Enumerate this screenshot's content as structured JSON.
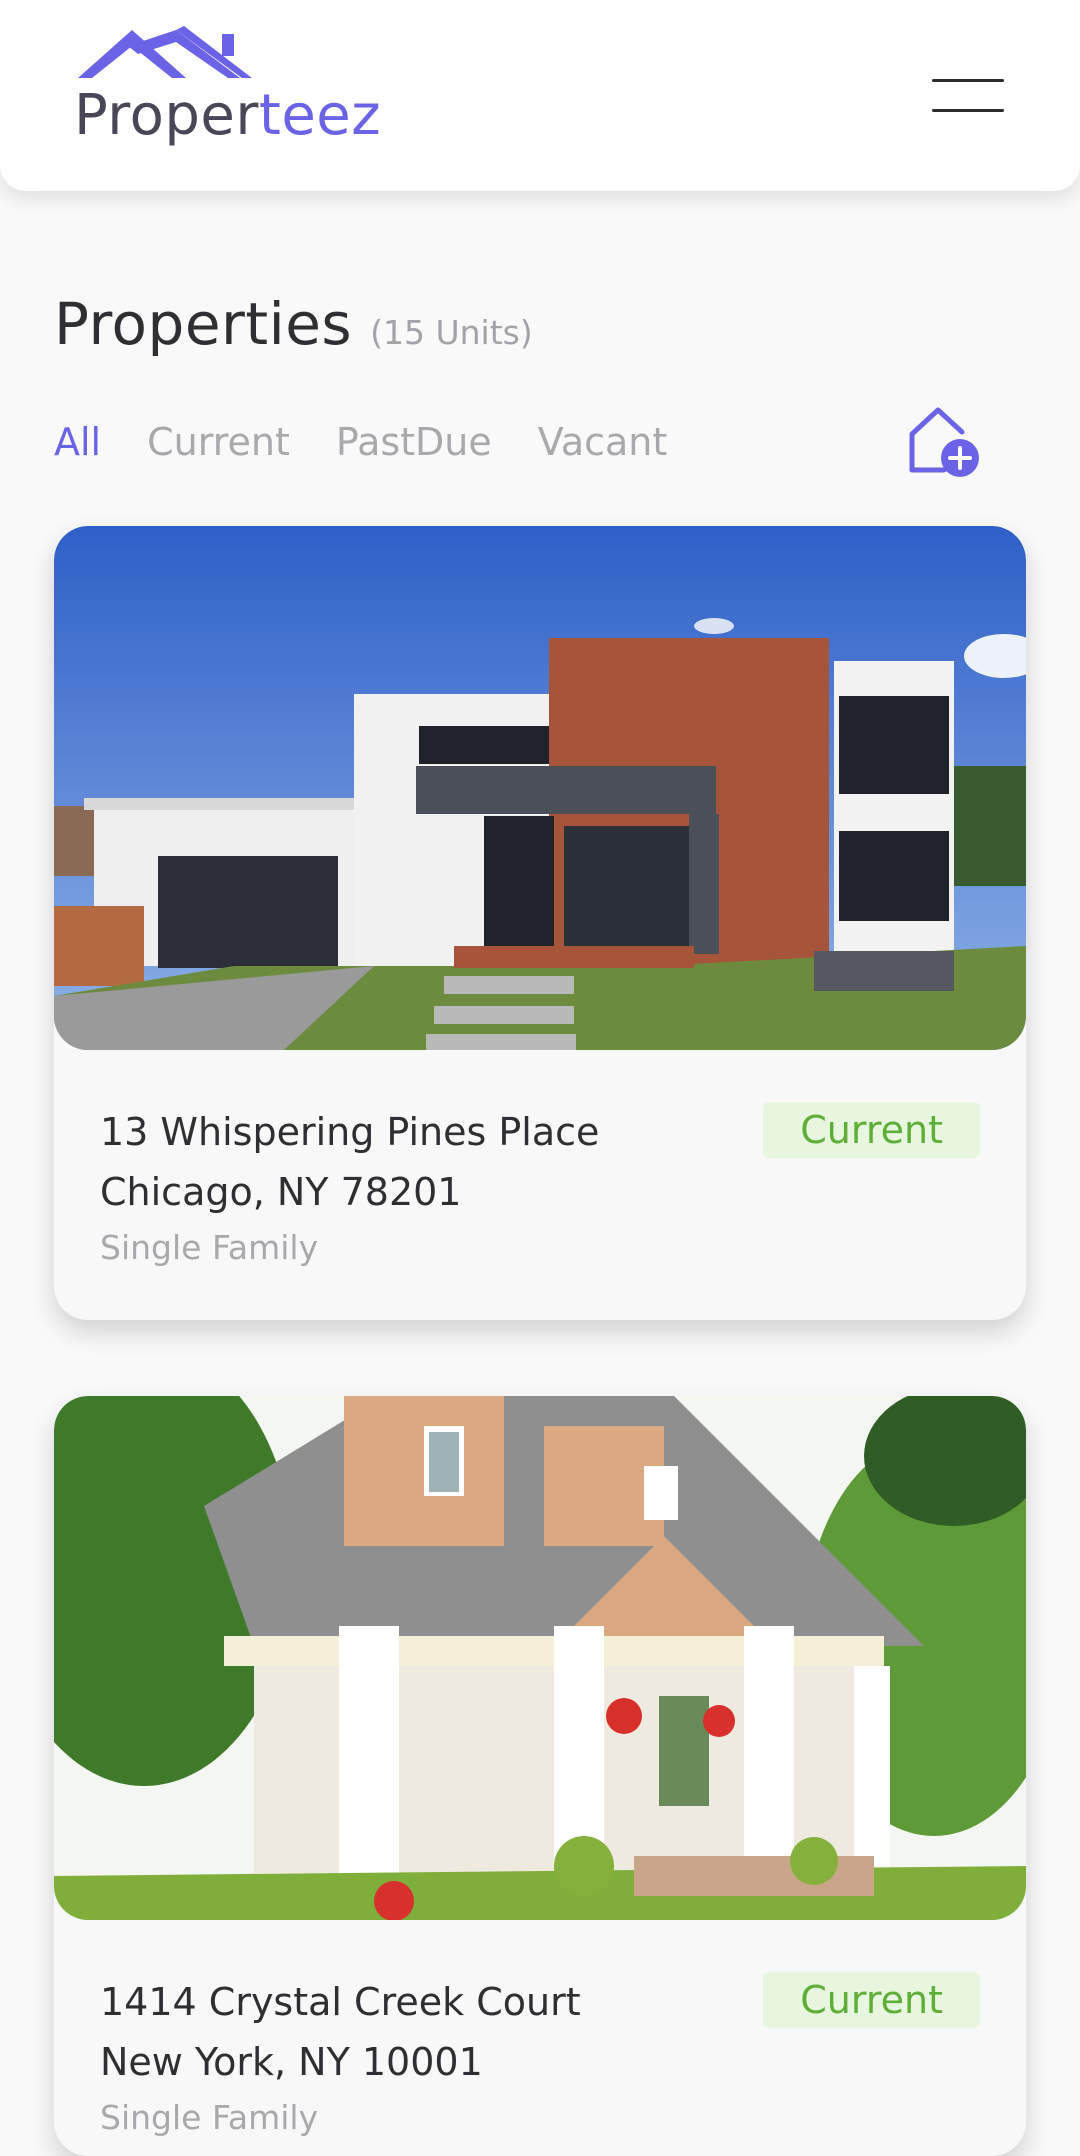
{
  "header": {
    "logo": {
      "part1": "Proper",
      "part2": "teez"
    }
  },
  "page": {
    "title": "Properties",
    "unit_count": "(15 Units)"
  },
  "filters": [
    {
      "label": "All",
      "active": true
    },
    {
      "label": "Current",
      "active": false
    },
    {
      "label": "PastDue",
      "active": false
    },
    {
      "label": "Vacant",
      "active": false
    }
  ],
  "colors": {
    "accent": "#6b63e6",
    "status_current_text": "#5eae37",
    "status_current_bg": "#e9f6df"
  },
  "properties": [
    {
      "street": "13 Whispering Pines Place",
      "city_line": "Chicago, NY 78201",
      "type": "Single Family",
      "status": "Current"
    },
    {
      "street": "1414 Crystal Creek Court",
      "city_line": "New York, NY 10001",
      "type": "Single Family",
      "status": "Current"
    }
  ]
}
